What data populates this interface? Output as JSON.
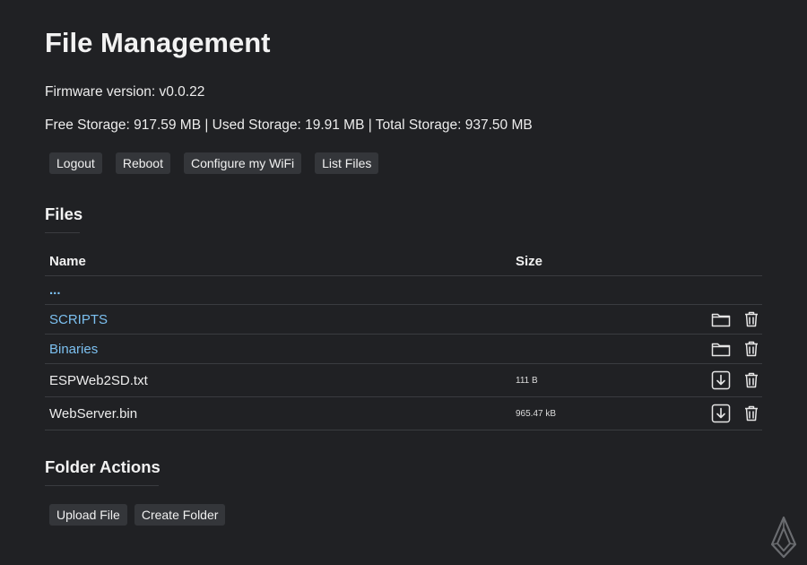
{
  "page": {
    "title": "File Management",
    "firmware": "Firmware version: v0.0.22",
    "storage": "Free Storage: 917.59 MB | Used Storage: 19.91 MB | Total Storage: 937.50 MB"
  },
  "toolbar": {
    "logout": "Logout",
    "reboot": "Reboot",
    "wifi": "Configure my WiFi",
    "list_files": "List Files"
  },
  "files": {
    "heading": "Files",
    "columns": {
      "name": "Name",
      "size": "Size"
    },
    "parent": "...",
    "rows": [
      {
        "name": "SCRIPTS",
        "size": "",
        "type": "folder"
      },
      {
        "name": "Binaries",
        "size": "",
        "type": "folder"
      },
      {
        "name": "ESPWeb2SD.txt",
        "size": "111 B",
        "type": "file"
      },
      {
        "name": "WebServer.bin",
        "size": "965.47 kB",
        "type": "file"
      }
    ]
  },
  "folder_actions": {
    "heading": "Folder Actions",
    "upload": "Upload File",
    "create": "Create Folder"
  },
  "icons": {
    "open_folder": "folder-icon",
    "download": "download-icon",
    "delete": "trash-icon",
    "logo": "logo-icon"
  },
  "colors": {
    "background": "#202124",
    "link": "#7cc0f0",
    "button": "#34363a"
  }
}
